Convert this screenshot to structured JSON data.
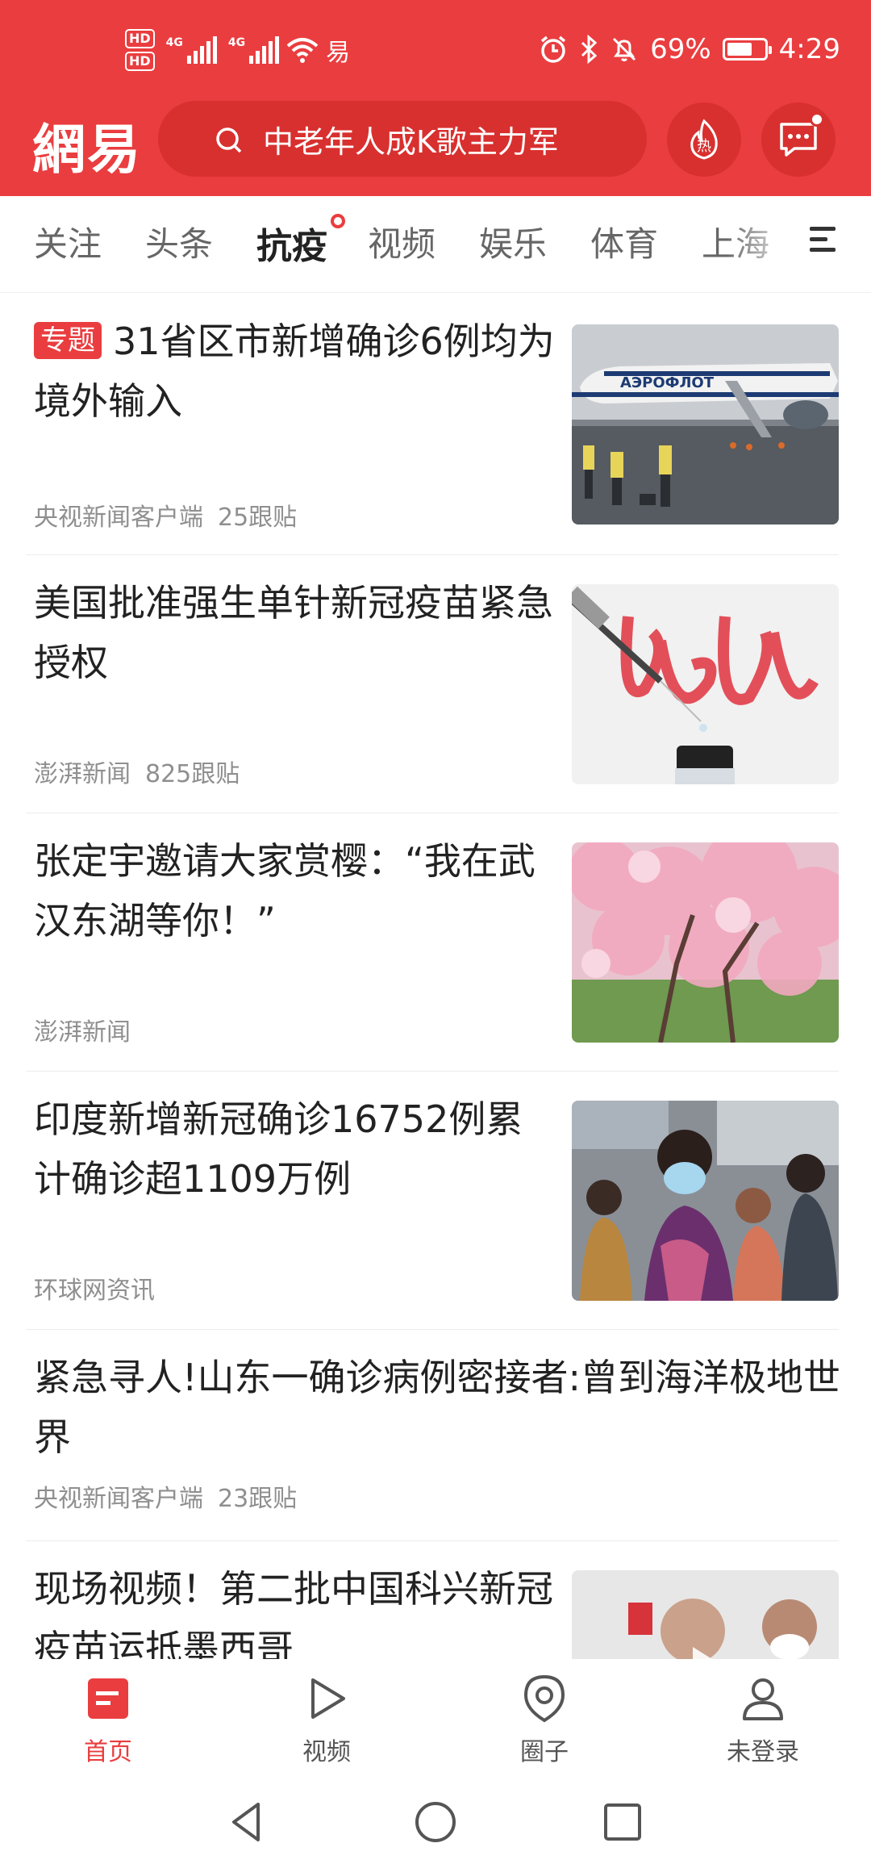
{
  "status_bar": {
    "hd1": "HD",
    "hd2": "HD",
    "net1": "4G",
    "net2": "4G",
    "carrier_glyph": "易",
    "battery_text": "69%",
    "battery_level": 0.69,
    "time": "4:29",
    "icons": [
      "alarm-icon",
      "bluetooth-icon",
      "mute-icon",
      "wifi-icon",
      "battery-icon"
    ]
  },
  "header": {
    "logo_text": "網易",
    "search_placeholder": "中老年人成K歌主力军",
    "hot_label": "热",
    "accent_color": "#ea3d3f"
  },
  "tabs": [
    {
      "label": "关注",
      "active": false
    },
    {
      "label": "头条",
      "active": false
    },
    {
      "label": "抗疫",
      "active": true
    },
    {
      "label": "视频",
      "active": false
    },
    {
      "label": "娱乐",
      "active": false
    },
    {
      "label": "体育",
      "active": false
    },
    {
      "label": "上海",
      "active": false
    }
  ],
  "feed": [
    {
      "tag": "专题",
      "title": "31省区市新增确诊6例均为境外输入",
      "source": "央视新闻客户端",
      "comments": "25跟贴",
      "image": "airplane-photo"
    },
    {
      "tag": "",
      "title": "美国批准强生单针新冠疫苗紧急授权",
      "source": "澎湃新闻",
      "comments": "825跟贴",
      "image": "vaccine-photo"
    },
    {
      "tag": "",
      "title": "张定宇邀请大家赏樱：“我在武汉东湖等你！”",
      "source": "澎湃新闻",
      "comments": "",
      "image": "cherry-blossom-photo"
    },
    {
      "tag": "",
      "title": "印度新增新冠确诊16752例累计确诊超1109万例",
      "source": "环球网资讯",
      "comments": "",
      "image": "india-street-photo"
    },
    {
      "tag": "",
      "title": "紧急寻人!山东一确诊病例密接者:曾到海洋极地世界",
      "source": "央视新闻客户端",
      "comments": "23跟贴",
      "image": ""
    },
    {
      "tag": "",
      "title": "现场视频！第二批中国科兴新冠疫苗运抵墨西哥",
      "source": "",
      "comments": "",
      "image": "video-photo"
    }
  ],
  "bottom_nav": [
    {
      "label": "首页",
      "icon": "home-icon",
      "active": true
    },
    {
      "label": "视频",
      "icon": "play-icon",
      "active": false
    },
    {
      "label": "圈子",
      "icon": "circle-icon",
      "active": false
    },
    {
      "label": "未登录",
      "icon": "user-icon",
      "active": false
    }
  ],
  "system_nav": [
    "back-icon",
    "home-circle-icon",
    "recents-icon"
  ]
}
